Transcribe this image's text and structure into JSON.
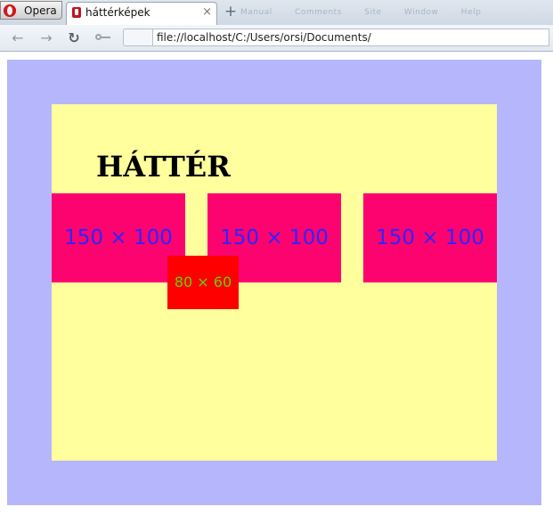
{
  "browser": {
    "menu_button_label": "Opera",
    "tab_title": "háttérképek",
    "tab_close": "×",
    "new_tab": "+",
    "faded_menu": [
      "Manual",
      "Comments",
      "Site",
      "Window",
      "Help"
    ],
    "url": "file://localhost/C:/Users/orsi/Documents/"
  },
  "page": {
    "heading": "HÁTTÉR",
    "boxes": [
      "150 × 100",
      "150 × 100",
      "150 × 100"
    ],
    "small_box": "80 × 60"
  },
  "colors": {
    "outer_background": "#b6b6fc",
    "inner_background": "#ffff9d",
    "big_box": "#fc0370",
    "big_box_text": "#2b25ff",
    "small_box": "#ff0000",
    "small_box_text": "#66d100"
  },
  "icons": {
    "back": "back-arrow-icon",
    "forward": "forward-arrow-icon",
    "reload": "reload-icon",
    "key": "key-icon",
    "opera_logo": "opera-logo-icon",
    "tab_favicon": "page-favicon-icon"
  }
}
